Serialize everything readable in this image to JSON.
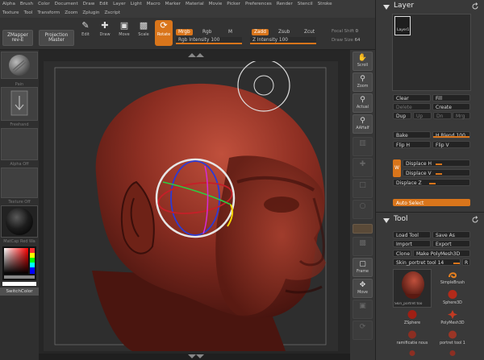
{
  "menu": {
    "row1": [
      "Alpha",
      "Brush",
      "Color",
      "Document",
      "Draw",
      "Edit",
      "Layer",
      "Light",
      "Macro",
      "Marker",
      "Material",
      "Movie",
      "Picker",
      "Preferences",
      "Render",
      "Stencil",
      "Stroke"
    ],
    "row2": [
      "Texture",
      "Tool",
      "Transform",
      "Zoom",
      "Zplugin",
      "Zscript"
    ]
  },
  "toolbar": {
    "zmapper": "ZMapper",
    "zmapper_rev": "rev-E",
    "projection_master_1": "Projection",
    "projection_master_2": "Master",
    "tools": [
      "Edit",
      "Draw",
      "Move",
      "Scale",
      "Rotate"
    ],
    "mrgb": "Mrgb",
    "rgb": "Rgb",
    "m": "M",
    "zadd": "Zadd",
    "zsub": "Zsub",
    "zcut": "Zcut",
    "rgb_intensity_label": "Rgb Intensity",
    "rgb_intensity_value": "100",
    "rgb_intensity_fraction": 1.0,
    "z_intensity_label": "Z Intensity",
    "z_intensity_value": "100",
    "z_intensity_fraction": 1.0,
    "focal_shift_label": "Focal Shift",
    "focal_shift_value": "0",
    "draw_size_label": "Draw Size",
    "draw_size_value": "64"
  },
  "left_panel": {
    "brush_label": "Pain",
    "stroke_label": "Freehand",
    "alpha_label": "Alpha Off",
    "texture_label": "Texture Off",
    "material_label": "MatCap Red Wa",
    "switch_color": "SwitchColor"
  },
  "nav": {
    "scroll": "Scroll",
    "zoom": "Zoom",
    "actual": "Actual",
    "aahalf": "AAHalf",
    "frame": "Frame",
    "move": "Move"
  },
  "layer_palette": {
    "title": "Layer",
    "layer_thumb_label": "Layer1",
    "clear": "Clear",
    "fill": "Fill",
    "delete": "Delete",
    "create": "Create",
    "dup": "Dup",
    "up": "Up",
    "dn": "Dn",
    "mrg": "Mrg",
    "bake": "Bake",
    "h_blend_label": "H Blend",
    "h_blend_value": "100",
    "h_blend_fraction": 1.0,
    "flip_h": "Flip H",
    "flip_v": "Flip V",
    "w": "W",
    "displace_h": "Displace H",
    "displace_v": "Displace V",
    "displace_z": "Displace Z",
    "auto_select": "Auto Select"
  },
  "tool_palette": {
    "title": "Tool",
    "load_tool": "Load Tool",
    "save_as": "Save As",
    "import": "Import",
    "export": "Export",
    "clone": "Clone",
    "make_polymesh": "Make PolyMesh3D",
    "current_tool": "Skin_portret tool 14",
    "r": "R",
    "current_thumb_label": "Skin_portret too",
    "items": [
      "SimpleBrush",
      "Sphere3D",
      "ZSphere",
      "PolyMesh3D",
      "ramificatie nous",
      "portret tool 1"
    ]
  },
  "colors": {
    "accent": "#d9751b",
    "head": "#8c2e22",
    "panel": "#393939"
  }
}
